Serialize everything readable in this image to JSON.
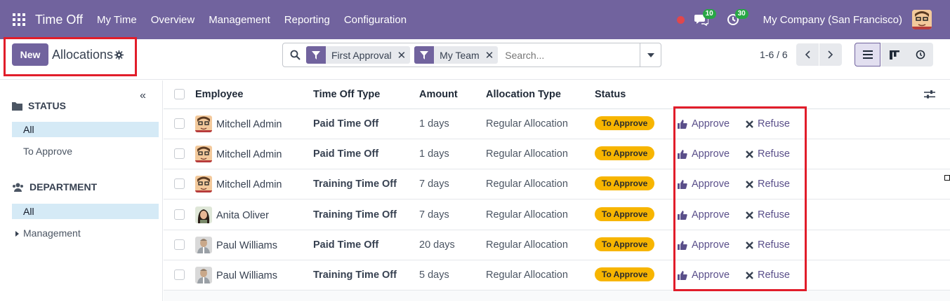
{
  "topnav": {
    "app_title": "Time Off",
    "menu": [
      "My Time",
      "Overview",
      "Management",
      "Reporting",
      "Configuration"
    ],
    "messages_count": "10",
    "activities_count": "30",
    "company": "My Company (San Francisco)"
  },
  "control": {
    "new_label": "New",
    "breadcrumb": "Allocations",
    "facets": [
      "First Approval",
      "My Team"
    ],
    "search_placeholder": "Search...",
    "pager": "1-6 / 6"
  },
  "sidebar": {
    "status_header": "STATUS",
    "status_items": [
      "All",
      "To Approve"
    ],
    "department_header": "DEPARTMENT",
    "department_items": [
      "All",
      "Management"
    ]
  },
  "table": {
    "columns": [
      "Employee",
      "Time Off Type",
      "Amount",
      "Allocation Type",
      "Status"
    ],
    "approve_label": "Approve",
    "refuse_label": "Refuse",
    "rows": [
      {
        "employee": "Mitchell Admin",
        "type": "Paid Time Off",
        "amount": "1 days",
        "allocation": "Regular Allocation",
        "status": "To Approve"
      },
      {
        "employee": "Mitchell Admin",
        "type": "Paid Time Off",
        "amount": "1 days",
        "allocation": "Regular Allocation",
        "status": "To Approve"
      },
      {
        "employee": "Mitchell Admin",
        "type": "Training Time Off",
        "amount": "7 days",
        "allocation": "Regular Allocation",
        "status": "To Approve"
      },
      {
        "employee": "Anita Oliver",
        "type": "Training Time Off",
        "amount": "7 days",
        "allocation": "Regular Allocation",
        "status": "To Approve"
      },
      {
        "employee": "Paul Williams",
        "type": "Paid Time Off",
        "amount": "20 days",
        "allocation": "Regular Allocation",
        "status": "To Approve"
      },
      {
        "employee": "Paul Williams",
        "type": "Training Time Off",
        "amount": "5 days",
        "allocation": "Regular Allocation",
        "status": "To Approve"
      }
    ]
  },
  "colors": {
    "brand": "#71639e",
    "badge": "#f7b500",
    "highlight": "#e11d2a",
    "sidebar_active": "#d5eaf6"
  }
}
